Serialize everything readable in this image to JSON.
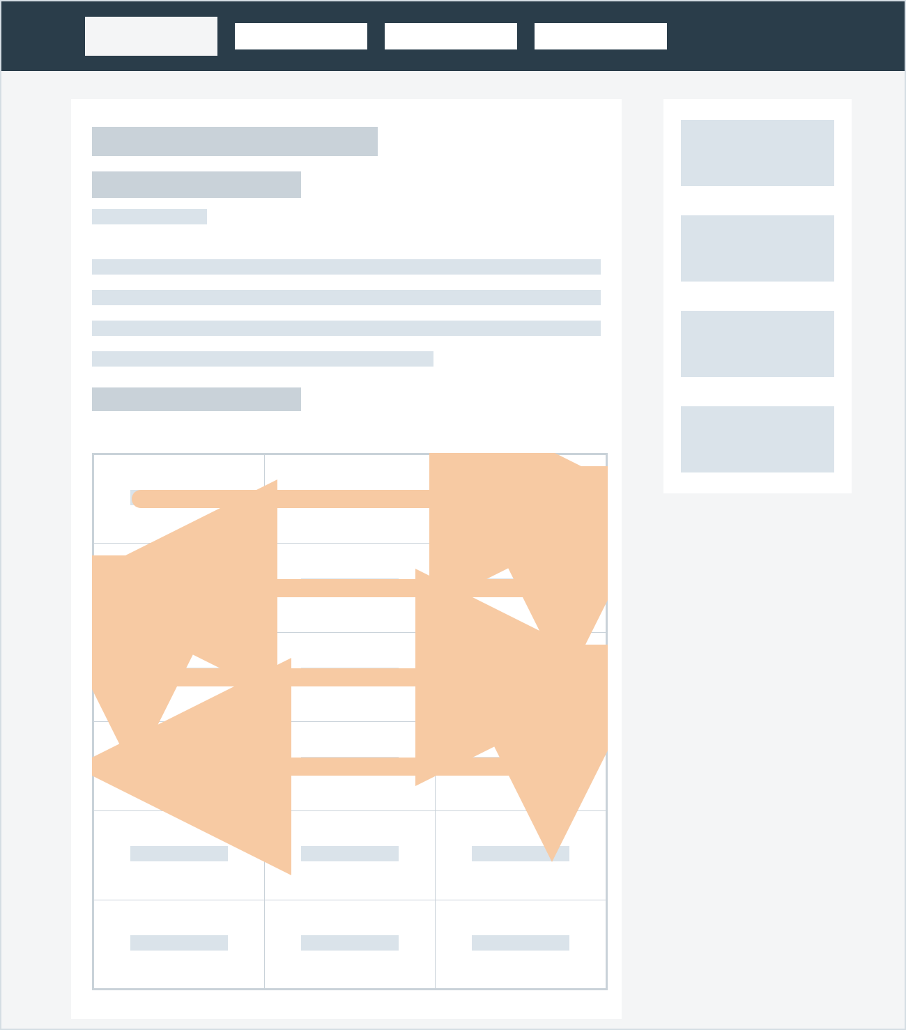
{
  "topbar": {
    "logo": "",
    "nav": [
      "",
      "",
      ""
    ]
  },
  "main": {
    "title": "",
    "subtitle": "",
    "meta": "",
    "paragraph_lines": [
      "",
      "",
      "",
      ""
    ],
    "section_heading": "",
    "table": {
      "rows": 6,
      "cols": 3,
      "cells": [
        [
          "",
          "",
          ""
        ],
        [
          "",
          "",
          ""
        ],
        [
          "",
          "",
          ""
        ],
        [
          "",
          "",
          ""
        ],
        [
          "",
          "",
          ""
        ],
        [
          "",
          "",
          ""
        ]
      ]
    }
  },
  "sidebar": {
    "blocks": [
      "",
      "",
      "",
      ""
    ]
  },
  "diagram": {
    "description": "Serpentine reading order arrows over first four table rows: row1 left-to-right, down to row2, row2 right-to-left, down to row3, row3 left-to-right, down to row4, row4 right-to-left.",
    "arrow_color": "#f7caa3",
    "segments": [
      {
        "type": "h",
        "row": 1,
        "dir": "right"
      },
      {
        "type": "v",
        "from_row": 1,
        "to_row": 2,
        "col": 3
      },
      {
        "type": "h",
        "row": 2,
        "dir": "left"
      },
      {
        "type": "v",
        "from_row": 2,
        "to_row": 3,
        "col": 1
      },
      {
        "type": "h",
        "row": 3,
        "dir": "right"
      },
      {
        "type": "v",
        "from_row": 3,
        "to_row": 4,
        "col": 3
      },
      {
        "type": "h",
        "row": 4,
        "dir": "left"
      }
    ]
  }
}
